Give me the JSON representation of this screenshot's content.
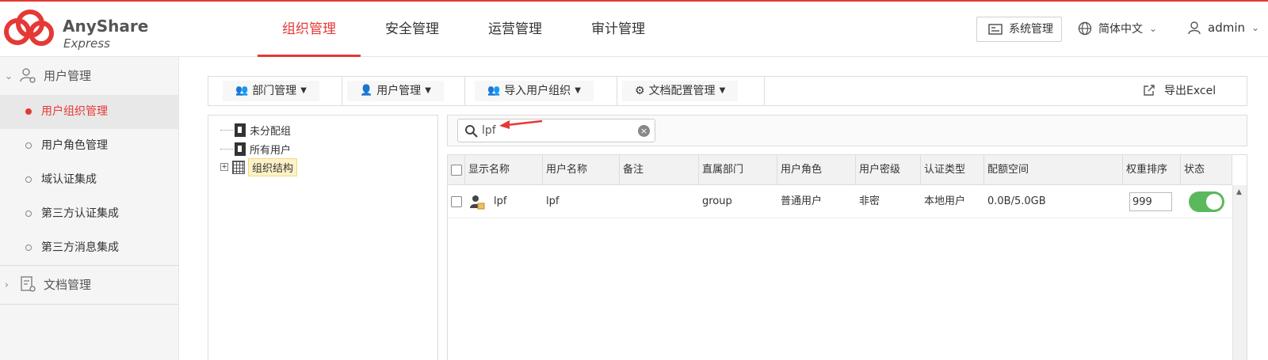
{
  "brand": {
    "name": "AnyShare",
    "edition": "Express",
    "accent": "#e53935"
  },
  "topnav": [
    {
      "label": "组织管理",
      "active": true
    },
    {
      "label": "安全管理",
      "active": false
    },
    {
      "label": "运营管理",
      "active": false
    },
    {
      "label": "审计管理",
      "active": false
    }
  ],
  "header": {
    "system_label": "系统管理",
    "language": "简体中文",
    "user": "admin"
  },
  "sidebar": {
    "groups": [
      {
        "label": "用户管理",
        "expanded": true,
        "items": [
          {
            "label": "用户组织管理",
            "active": true
          },
          {
            "label": "用户角色管理",
            "active": false
          },
          {
            "label": "域认证集成",
            "active": false
          },
          {
            "label": "第三方认证集成",
            "active": false
          },
          {
            "label": "第三方消息集成",
            "active": false
          }
        ]
      },
      {
        "label": "文档管理",
        "expanded": false,
        "items": []
      }
    ]
  },
  "toolbar": {
    "dept": "部门管理",
    "user": "用户管理",
    "import": "导入用户组织",
    "docconf": "文档配置管理",
    "export": "导出Excel"
  },
  "tree": [
    {
      "label": "未分配组"
    },
    {
      "label": "所有用户"
    },
    {
      "label": "组织结构",
      "selected": true
    }
  ],
  "search": {
    "value": "lpf"
  },
  "table": {
    "columns": [
      "显示名称",
      "用户名称",
      "备注",
      "直属部门",
      "用户角色",
      "用户密级",
      "认证类型",
      "配额空间",
      "权重排序",
      "状态"
    ],
    "rows": [
      {
        "display_name": "lpf",
        "username": "lpf",
        "note": "",
        "department": "group",
        "role": "普通用户",
        "secret_level": "非密",
        "auth_type": "本地用户",
        "quota": "0.0B/5.0GB",
        "weight": "999",
        "enabled": true
      }
    ]
  }
}
